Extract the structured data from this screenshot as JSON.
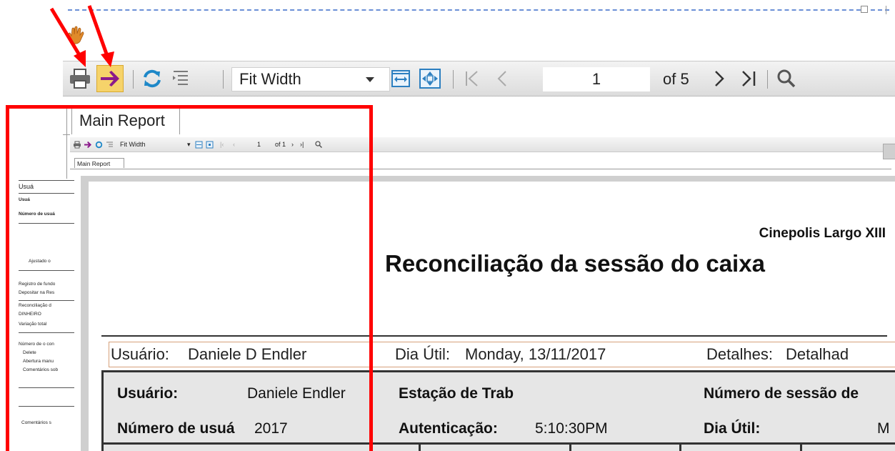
{
  "toolbar": {
    "zoom_value": "Fit Width",
    "page_value": "1",
    "page_of": "of 5",
    "icons": [
      "print-icon",
      "export-icon",
      "refresh-icon",
      "toggle-tree-icon",
      "page-width-icon",
      "whole-page-icon",
      "first-page-icon",
      "previous-page-icon",
      "next-page-icon",
      "last-page-icon",
      "search-icon"
    ]
  },
  "tabs": {
    "main": "Main Report"
  },
  "inner_viewer": {
    "zoom_value": "Fit Width",
    "page_value": "1",
    "page_of": "of 1",
    "tab": "Main Report"
  },
  "left_strip": {
    "lines": [
      "Usuá",
      "Usuá",
      "Número de usuá",
      "Ajustado o",
      "Registro de fundo",
      "Depositar na Res",
      "Reconciliação d",
      "DINHEIRO",
      "Variação total",
      "Número de o con",
      "Delete",
      "Abertura manu",
      "Comentários sob",
      "Comentários s"
    ]
  },
  "report": {
    "cinema": "Cinepolis Largo XIII",
    "title": "Reconciliação da sessão do caixa",
    "info": {
      "user_label": "Usuário:",
      "user_value": "Daniele D Endler",
      "day_label": "Dia Útil:",
      "day_value": "Monday, 13/11/2017",
      "details_label": "Detalhes:",
      "details_value": "Detalhad"
    },
    "details": {
      "user_label": "Usuário:",
      "user_value": "Daniele Endler",
      "station_label": "Estação de Trab",
      "session_label": "Número de sessão de",
      "usernum_label": "Número de usuá",
      "usernum_value": "2017",
      "auth_label": "Autenticação:",
      "auth_value": "5:10:30PM",
      "day_label": "Dia Útil:",
      "day_value": "M"
    }
  },
  "colors": {
    "annotation": "#ff0000",
    "export_arrow": "#8b1a8b",
    "export_bg": "#f2c94c",
    "refresh": "#1e88c8"
  }
}
